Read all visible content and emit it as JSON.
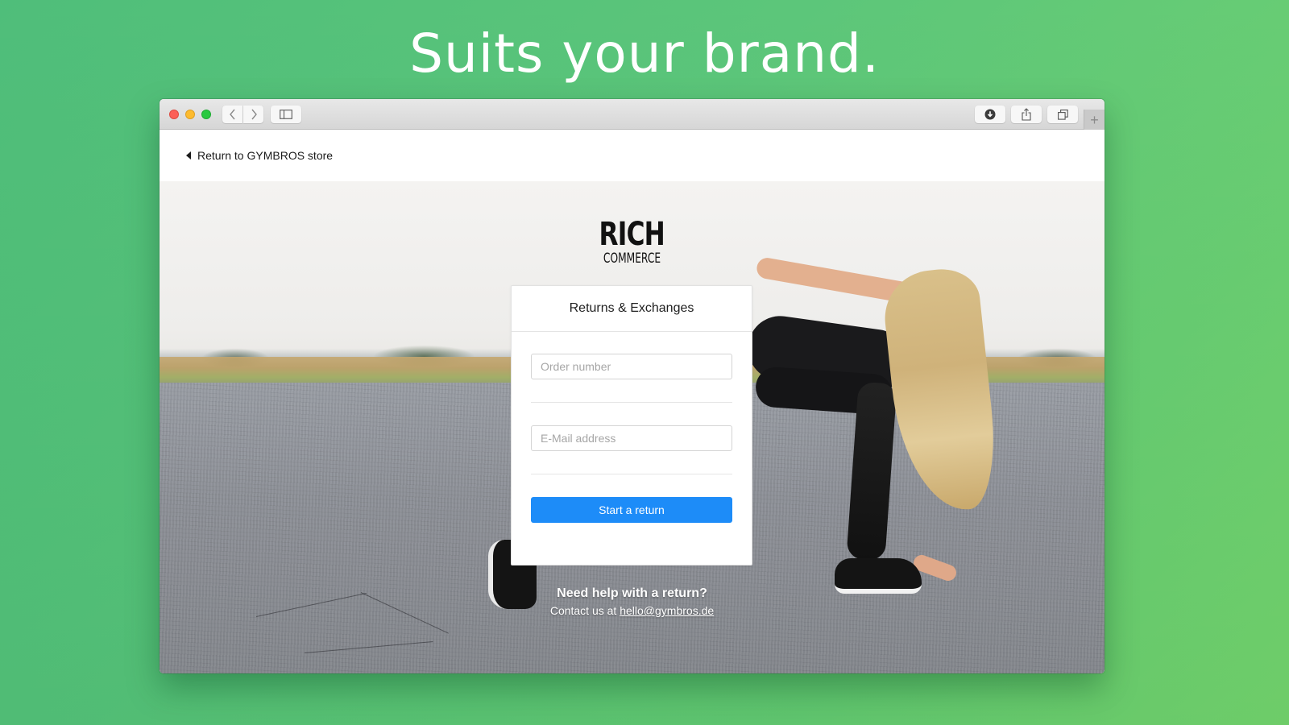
{
  "headline": "Suits your brand.",
  "browser": {
    "toolbar": {
      "back_icon": "chevron-left-icon",
      "forward_icon": "chevron-right-icon",
      "sidebar_icon": "sidebar-icon",
      "download_icon": "download-icon",
      "share_icon": "share-icon",
      "tabs_icon": "tabs-overview-icon",
      "new_tab_label": "+"
    }
  },
  "page": {
    "back_link": "Return to GYMBROS store",
    "logo": {
      "line1": "RICH",
      "line2": "COMMERCE"
    },
    "card": {
      "title": "Returns & Exchanges",
      "order_placeholder": "Order number",
      "order_value": "",
      "email_placeholder": "E-Mail address",
      "email_value": "",
      "submit_label": "Start a return"
    },
    "help": {
      "title": "Need help with a return?",
      "contact_prefix": "Contact us at",
      "contact_email": "hello@gymbros.de"
    }
  },
  "colors": {
    "accent_button": "#1d8cf8",
    "background_green": "#5cc67a"
  }
}
